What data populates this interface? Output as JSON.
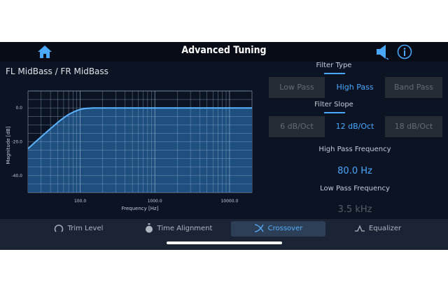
{
  "header": {
    "title": "Advanced Tuning"
  },
  "channel": {
    "title": "FL MidBass / FR MidBass"
  },
  "filter_type": {
    "label": "Filter Type",
    "options": [
      "Low Pass",
      "High Pass",
      "Band Pass"
    ],
    "selected": "High Pass"
  },
  "filter_slope": {
    "label": "Filter Slope",
    "options": [
      "6 dB/Oct",
      "12 dB/Oct",
      "18 dB/Oct"
    ],
    "selected": "12 dB/Oct"
  },
  "high_pass": {
    "label": "High Pass Frequency",
    "value": "80.0 Hz"
  },
  "low_pass": {
    "label": "Low Pass Frequency",
    "value": "3.5 kHz"
  },
  "tabs": [
    {
      "label": "Trim Level",
      "icon": "trim-icon"
    },
    {
      "label": "Time Alignment",
      "icon": "stopwatch-icon"
    },
    {
      "label": "Crossover",
      "icon": "crossover-icon",
      "active": true
    },
    {
      "label": "Equalizer",
      "icon": "equalizer-icon"
    }
  ],
  "colors": {
    "accent": "#4aa8ff",
    "background": "#0c1424",
    "header": "#070c17",
    "plot_fill": "#1f4f7e",
    "button_off": "#262c33"
  },
  "chart_data": {
    "type": "area",
    "xlabel": "Frequency [Hz]",
    "ylabel": "Magnitude [dB]",
    "x_scale": "log",
    "xlim": [
      20,
      20000
    ],
    "ylim": [
      -50,
      10
    ],
    "x_ticks": [
      {
        "value": 100,
        "label": "100.0"
      },
      {
        "value": 1000,
        "label": "1000.0"
      },
      {
        "value": 10000,
        "label": "10000.0"
      }
    ],
    "y_ticks": [
      {
        "value": 0,
        "label": "0.0"
      },
      {
        "value": -20,
        "label": "-20.0"
      },
      {
        "value": -40,
        "label": "-40.0"
      }
    ],
    "grid": true,
    "series": [
      {
        "x": [
          20,
          25,
          30,
          35,
          40,
          45,
          50,
          55,
          60,
          65,
          70,
          75,
          80,
          85,
          90,
          95,
          100,
          110,
          120,
          150,
          200,
          500,
          1000,
          5000,
          20000
        ],
        "values": [
          -24.1,
          -20.2,
          -17.1,
          -14.5,
          -12.2,
          -10.3,
          -8.6,
          -7.1,
          -5.9,
          -4.8,
          -3.9,
          -3.2,
          -2.6,
          -2.0,
          -1.6,
          -1.2,
          -0.9,
          -0.5,
          -0.3,
          0,
          0,
          0,
          0,
          0,
          0
        ]
      }
    ]
  }
}
